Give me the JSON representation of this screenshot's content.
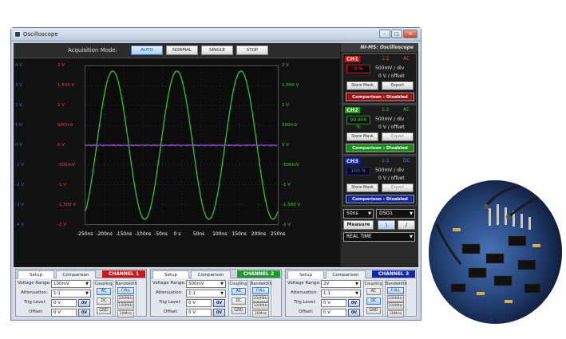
{
  "window": {
    "title": "Oscilloscope"
  },
  "acquisition": {
    "label": "Acquisition Mode:",
    "buttons": [
      "AUTO",
      "NORMAL",
      "SINGLE",
      "STOP"
    ],
    "active": "AUTO"
  },
  "axes": {
    "left_blue": [
      "4 V",
      "3 V",
      "2 V",
      "1 V",
      "0 V",
      "-1 V",
      "-2 V",
      "-3 V",
      "-4 V"
    ],
    "left_red": [
      "2 V",
      "1,500 V",
      "1 V",
      "500mV",
      "0 V",
      "-500mV",
      "-1 V",
      "-1,500 V",
      "-2 V"
    ],
    "right_green": [
      "2 V",
      "1,500 V",
      "1 V",
      "500mV",
      "0 V",
      "-500mV",
      "-1 V",
      "-1,500 V",
      "-2 V"
    ],
    "x": [
      "-250ns",
      "-200ns",
      "-150ns",
      "-100ns",
      "-50ns",
      "0 s",
      "50ns",
      "100ns",
      "150ns",
      "200ns",
      "250ns"
    ]
  },
  "right_panel": {
    "title": "NI-MS: Oscilloscope",
    "channels": [
      {
        "name": "CH1",
        "ratio": "1:1",
        "coupling": "AC",
        "percent": "0 %",
        "div": "500mV / div",
        "offset": "0 V  / offset",
        "store_label": "Store Mask",
        "export_label": "Export",
        "comparison": "Comparison : Disabled",
        "color": "#d01010"
      },
      {
        "name": "CH2",
        "ratio": "1:1",
        "coupling": "AC",
        "percent": "99,600 %",
        "div": "500mV / div",
        "offset": "0 V  / offset",
        "store_label": "Store Mask",
        "export_label": "Export",
        "comparison": "Comparison : Disabled",
        "color": "#1a9a1a"
      },
      {
        "name": "CH3",
        "ratio": "1:1",
        "coupling": "DC",
        "percent": "100 %",
        "div": "500mV / div",
        "offset": "0 V  / offset",
        "store_label": "Store Mask",
        "export_label": "Export",
        "comparison": "Comparison : Disabled",
        "color": "#1428b0"
      }
    ],
    "timebase": "50ns",
    "device": "DSO1",
    "measure_label": "Measure",
    "slope_rising": "\\",
    "slope_falling": "/",
    "mode": "REAL TIME"
  },
  "channel_panels": [
    {
      "tab_setup": "Setup",
      "tab_comparison": "Comparison",
      "title": "CHANNEL 1",
      "color": "#c81818",
      "voltage_range_label": "Voltage Range:",
      "voltage_range": "100mV",
      "attenuation_label": "Attenuation:",
      "attenuation": "1:1",
      "trig_level_label": "Trig Level:",
      "trig_level": "0 V",
      "offset_label": "Offset:",
      "offset": "0 V",
      "zero_label": "0V",
      "coupling_label": "Coupling",
      "coupling_options": [
        "AC",
        "DC",
        "GND"
      ],
      "coupling_active": "AC",
      "bandwidth_label": "Bandwidth",
      "bandwidth_options": [
        "FULL",
        "200MHz",
        "100MHz",
        "20MHz"
      ],
      "bandwidth_active": "FULL"
    },
    {
      "tab_setup": "Setup",
      "tab_comparison": "Comparison",
      "title": "CHANNEL 2",
      "color": "#1f9a2a",
      "voltage_range_label": "Voltage Range:",
      "voltage_range": "500mV",
      "attenuation_label": "Attenuation:",
      "attenuation": "1:1",
      "trig_level_label": "Trig Level:",
      "trig_level": "0 V",
      "offset_label": "Offset:",
      "offset": "0 V",
      "zero_label": "0V",
      "coupling_label": "Coupling",
      "coupling_options": [
        "AC",
        "DC",
        "GND"
      ],
      "coupling_active": "AC",
      "bandwidth_label": "Bandwidth",
      "bandwidth_options": [
        "FULL",
        "200MHz",
        "100MHz",
        "20MHz"
      ],
      "bandwidth_active": "FULL"
    },
    {
      "tab_setup": "Setup",
      "tab_comparison": "Comparison",
      "title": "CHANNEL 3",
      "color": "#1428a8",
      "voltage_range_label": "Voltage Range:",
      "voltage_range": "2V",
      "attenuation_label": "Attenuation:",
      "attenuation": "1:1",
      "trig_level_label": "Trig Level:",
      "trig_level": "0 V",
      "offset_label": "Offset:",
      "offset": "0 V",
      "zero_label": "0V",
      "coupling_label": "Coupling",
      "coupling_options": [
        "AC",
        "DC",
        "GND"
      ],
      "coupling_active": "DC",
      "bandwidth_label": "Bandwidth",
      "bandwidth_options": [
        "FULL",
        "200MHz",
        "100MHz",
        "20MHz"
      ],
      "bandwidth_active": "FULL"
    }
  ]
}
